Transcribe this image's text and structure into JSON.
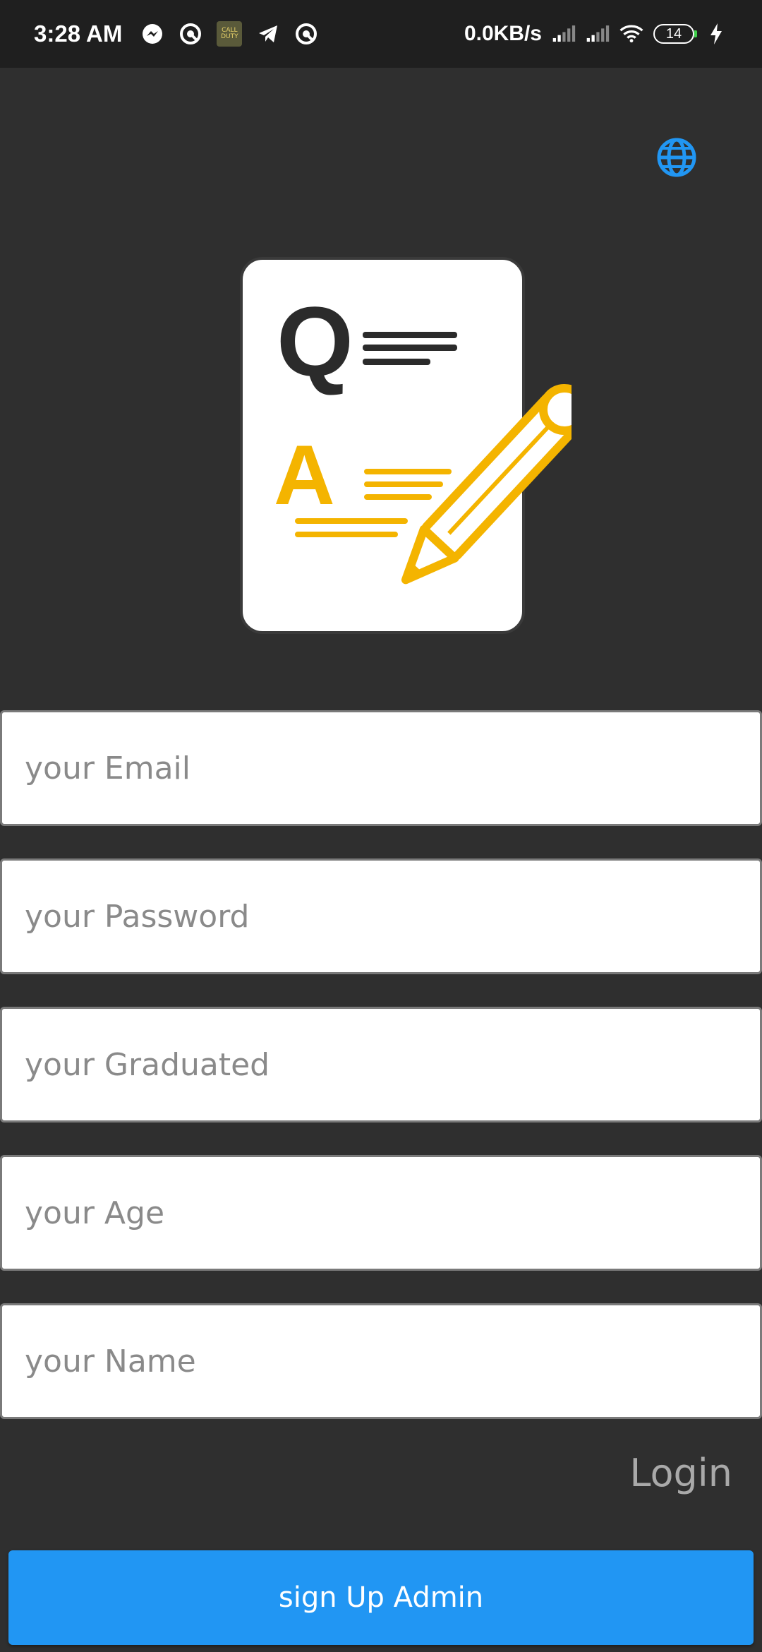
{
  "status_bar": {
    "time": "3:28 AM",
    "speed": "0.0KB/s",
    "battery": "14",
    "icons": [
      "messenger-icon",
      "vpn-icon",
      "call-of-duty-icon",
      "telegram-icon",
      "vpn-icon",
      "signal-icon",
      "signal-icon",
      "wifi-icon",
      "battery-icon",
      "charging-icon"
    ]
  },
  "header": {
    "language_icon": "globe-icon",
    "accent_color": "#2196f3"
  },
  "logo": {
    "icon": "quiz-document-pencil-icon",
    "letters": [
      "Q",
      "A"
    ],
    "accent_color": "#f4b400"
  },
  "form": {
    "email_placeholder": "your Email",
    "password_placeholder": "your Password",
    "graduated_placeholder": "your Graduated",
    "age_placeholder": "your Age",
    "name_placeholder": "your Name"
  },
  "actions": {
    "login_label": "Login",
    "signup_label": "sign Up Admin",
    "signup_color": "#2196f3"
  }
}
